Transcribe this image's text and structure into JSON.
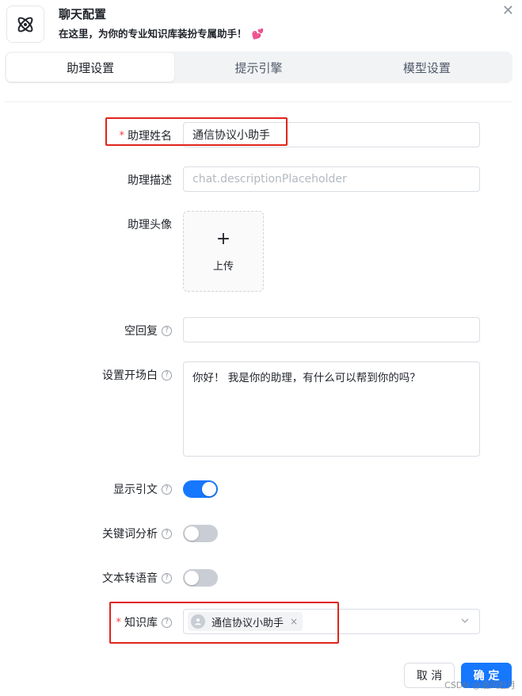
{
  "header": {
    "title": "聊天配置",
    "subtitle": "在这里，为你的专业知识库装扮专属助手！",
    "heart": "💕",
    "close": "✕"
  },
  "tabs": [
    {
      "label": "助理设置",
      "active": true
    },
    {
      "label": "提示引擎",
      "active": false
    },
    {
      "label": "模型设置",
      "active": false
    }
  ],
  "form": {
    "name": {
      "label": "助理姓名",
      "required": "*",
      "value": "通信协议小助手"
    },
    "description": {
      "label": "助理描述",
      "placeholder": "chat.descriptionPlaceholder"
    },
    "avatar": {
      "label": "助理头像",
      "upload_plus": "+",
      "upload_text": "上传"
    },
    "empty_reply": {
      "label": "空回复",
      "value": ""
    },
    "opening": {
      "label": "设置开场白",
      "value": "你好！ 我是你的助理，有什么可以帮到你的吗？"
    },
    "show_quote": {
      "label": "显示引文",
      "on": true
    },
    "keyword": {
      "label": "关键词分析",
      "on": false
    },
    "tts": {
      "label": "文本转语音",
      "on": false
    },
    "kb": {
      "label": "知识库",
      "required": "*",
      "tag": "通信协议小助手",
      "tag_close": "×"
    }
  },
  "help_glyph": "?",
  "buttons": {
    "cancel": "取 消",
    "ok": "确 定"
  },
  "watermark": "CSDN @追风赶月",
  "colors": {
    "accent": "#1677ff",
    "highlight_box": "#e0241b",
    "required": "#f53f3f"
  }
}
